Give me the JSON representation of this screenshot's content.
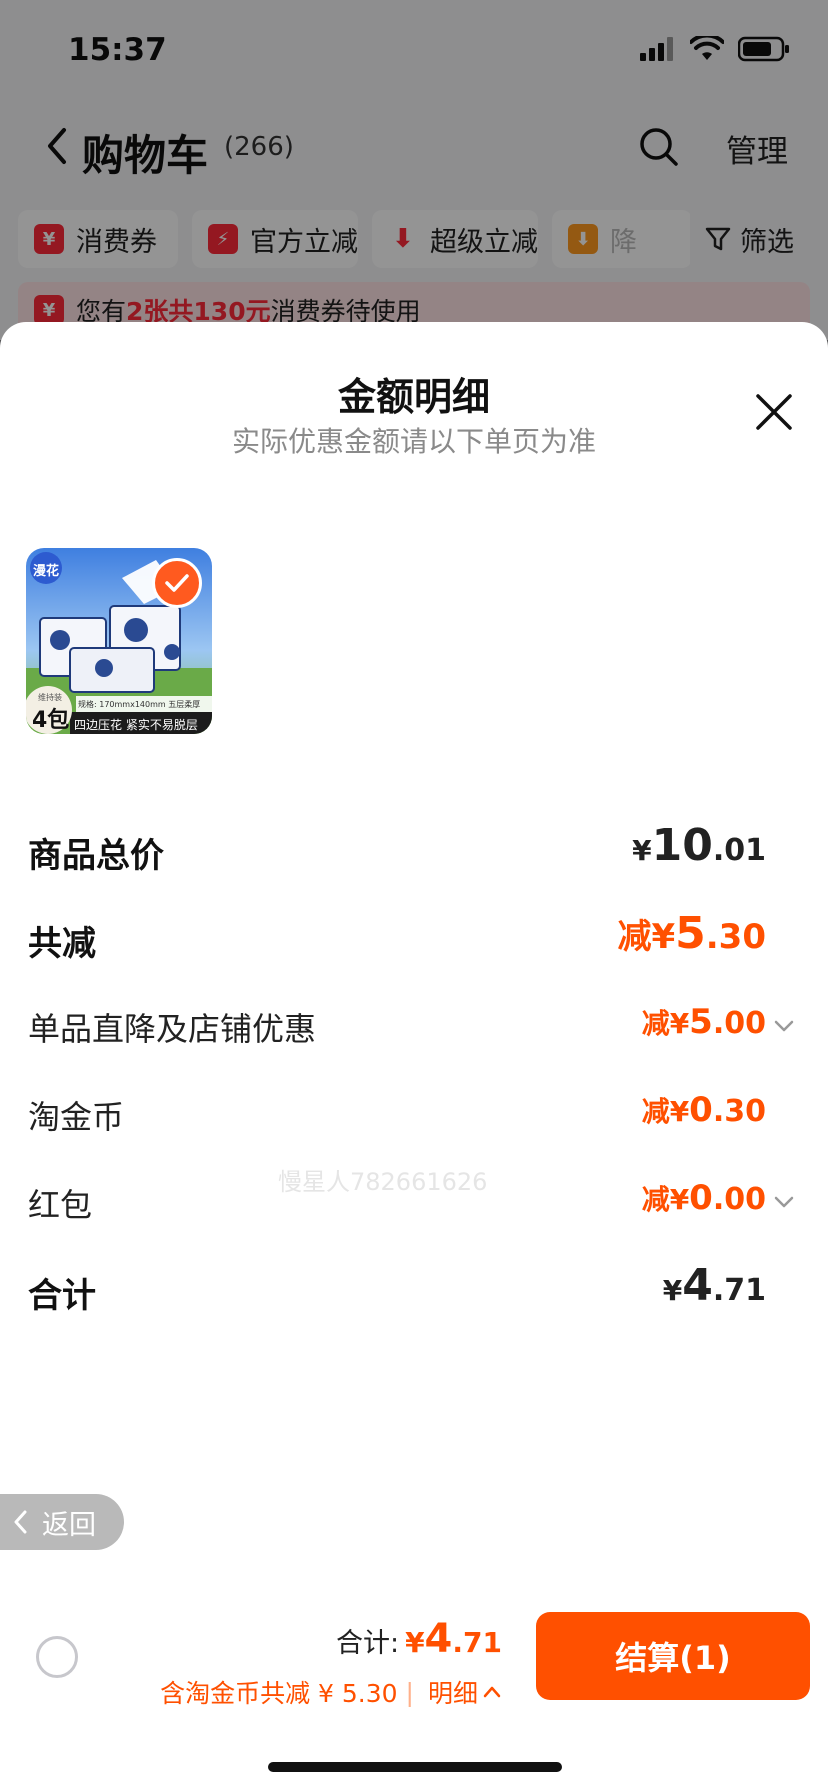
{
  "status_bar": {
    "time": "15:37"
  },
  "nav": {
    "title": "购物车",
    "count": "(266)",
    "manage_label": "管理"
  },
  "filter_chips": [
    {
      "icon": "coupon-icon",
      "label": "消费券"
    },
    {
      "icon": "lightning-icon",
      "label": "官方立减"
    },
    {
      "icon": "arrow-down-icon",
      "label": "超级立减"
    },
    {
      "icon": "price-drop-icon",
      "label": "降"
    }
  ],
  "filter_label": "筛选",
  "coupon_strip": {
    "prefix": "您有",
    "highlight": "2张共130元",
    "suffix": "消费券待使用"
  },
  "sheet": {
    "title": "金额明细",
    "subtitle": "实际优惠金额请以下单页为准",
    "product": {
      "brand_tag": "漫花",
      "pack_label": "4包",
      "pack_caption": "维持装",
      "spec_text": "规格: 170mmx140mm 五层柔厚",
      "banner_text": "四边压花 紧实不易脱层"
    },
    "rows": [
      {
        "label": "商品总价",
        "prefix": "¥",
        "int": "10",
        "dec": ".01",
        "style": "bold",
        "chevron": false
      },
      {
        "label": "共减",
        "prefix": "减¥",
        "int": "5",
        "dec": ".30",
        "style": "bold-orange",
        "chevron": false
      },
      {
        "label": "单品直降及店铺优惠",
        "prefix": "减¥",
        "int": "5",
        "dec": ".00",
        "style": "orange",
        "chevron": true
      },
      {
        "label": "淘金币",
        "prefix": "减¥",
        "int": "0",
        "dec": ".30",
        "style": "orange",
        "chevron": false
      },
      {
        "label": "红包",
        "prefix": "减¥",
        "int": "0",
        "dec": ".00",
        "style": "orange",
        "chevron": true
      },
      {
        "label": "合计",
        "prefix": "¥",
        "int": "4",
        "dec": ".71",
        "style": "bold",
        "chevron": false
      }
    ],
    "watermark": "慢星人782661626"
  },
  "back_pill": {
    "label": "返回"
  },
  "bottom_bar": {
    "total_label": "合计:",
    "total_prefix": "¥",
    "total_int": "4",
    "total_dec": ".71",
    "discount_text": "含淘金币共减 ¥ 5.30",
    "separator": "|",
    "detail_label": "明细",
    "checkout_label": "结算(1)"
  },
  "colors": {
    "accent": "#ff5000",
    "brand_red": "#ff2a3a"
  }
}
